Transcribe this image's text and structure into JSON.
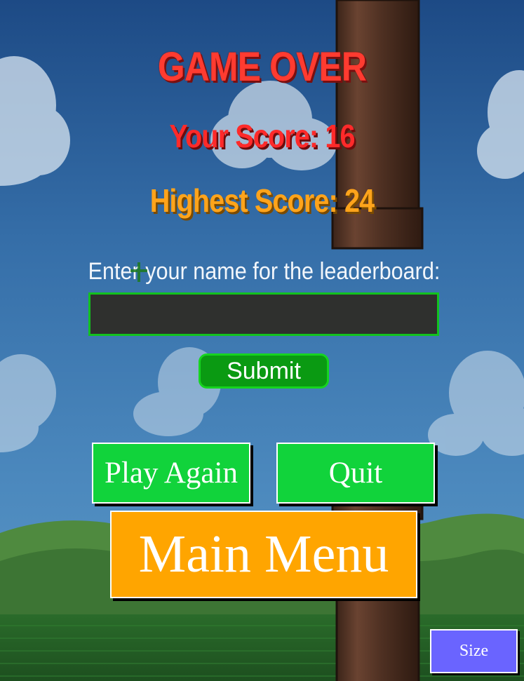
{
  "game": {
    "title": "GAME OVER",
    "your_score_label": "Your Score: 16",
    "your_score": 16,
    "highest_score_label": "Highest Score: 24",
    "highest_score": 24
  },
  "leaderboard": {
    "prompt": "Enter your name for the leaderboard:",
    "name_value": "",
    "submit_label": "Submit"
  },
  "buttons": {
    "play_again": "Play Again",
    "quit": "Quit",
    "main_menu": "Main Menu",
    "size": "Size"
  },
  "colors": {
    "title_red": "#ff3b30",
    "score_red": "#ff2a2a",
    "highscore_orange": "#ffa41b",
    "button_green": "#11d33b",
    "submit_green": "#0a9a12",
    "main_menu_orange": "#ffa500",
    "size_purple": "#6a64ff",
    "input_border": "#12c21e"
  }
}
